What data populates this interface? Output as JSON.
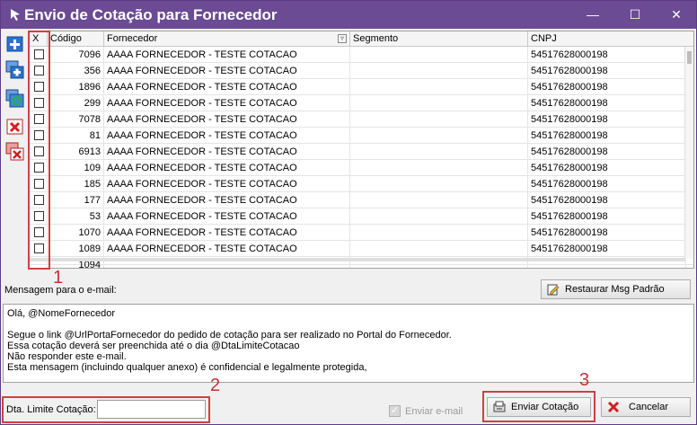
{
  "window": {
    "title": "Envio de Cotação para Fornecedor",
    "minimize": "—",
    "maximize": "☐",
    "close": "✕"
  },
  "grid": {
    "columns": [
      "X",
      "Código",
      "Fornecedor",
      "Segmento",
      "CNPJ"
    ],
    "rows": [
      {
        "codigo": "7096",
        "fornecedor": "AAAA FORNECEDOR - TESTE COTACAO",
        "segmento": "",
        "cnpj": "54517628000198"
      },
      {
        "codigo": "356",
        "fornecedor": "AAAA FORNECEDOR - TESTE COTACAO",
        "segmento": "",
        "cnpj": "54517628000198"
      },
      {
        "codigo": "1896",
        "fornecedor": "AAAA FORNECEDOR - TESTE COTACAO",
        "segmento": "",
        "cnpj": "54517628000198"
      },
      {
        "codigo": "299",
        "fornecedor": "AAAA FORNECEDOR - TESTE COTACAO",
        "segmento": "",
        "cnpj": "54517628000198"
      },
      {
        "codigo": "7078",
        "fornecedor": "AAAA FORNECEDOR - TESTE COTACAO",
        "segmento": "",
        "cnpj": "54517628000198"
      },
      {
        "codigo": "81",
        "fornecedor": "AAAA FORNECEDOR - TESTE COTACAO",
        "segmento": "",
        "cnpj": "54517628000198"
      },
      {
        "codigo": "6913",
        "fornecedor": "AAAA FORNECEDOR - TESTE COTACAO",
        "segmento": "",
        "cnpj": "54517628000198"
      },
      {
        "codigo": "109",
        "fornecedor": "AAAA FORNECEDOR - TESTE COTACAO",
        "segmento": "",
        "cnpj": "54517628000198"
      },
      {
        "codigo": "185",
        "fornecedor": "AAAA FORNECEDOR - TESTE COTACAO",
        "segmento": "",
        "cnpj": "54517628000198"
      },
      {
        "codigo": "177",
        "fornecedor": "AAAA FORNECEDOR - TESTE COTACAO",
        "segmento": "",
        "cnpj": "54517628000198"
      },
      {
        "codigo": "53",
        "fornecedor": "AAAA FORNECEDOR - TESTE COTACAO",
        "segmento": "",
        "cnpj": "54517628000198"
      },
      {
        "codigo": "1070",
        "fornecedor": "AAAA FORNECEDOR - TESTE COTACAO",
        "segmento": "",
        "cnpj": "54517628000198"
      },
      {
        "codigo": "1089",
        "fornecedor": "AAAA FORNECEDOR - TESTE COTACAO",
        "segmento": "",
        "cnpj": "54517628000198"
      },
      {
        "codigo": "1094",
        "fornecedor": "",
        "segmento": "",
        "cnpj": ""
      }
    ]
  },
  "annotations": [
    "1",
    "2",
    "3"
  ],
  "message": {
    "label": "Mensagem para o e-mail:",
    "restore_button": "Restaurar Msg Padrão",
    "lines": [
      "Olá, @NomeFornecedor",
      "",
      "Segue o link @UrlPortaFornecedor do pedido de cotação para ser realizado no Portal do Fornecedor.",
      "Essa cotação deverá ser preenchida até o dia @DtaLimiteCotacao",
      "Não responder este e-mail.",
      "Esta mensagem (incluindo qualquer anexo) é confidencial e legalmente protegida,"
    ]
  },
  "footer": {
    "deadline_label": "Dta. Limite Cotação:",
    "deadline_value": "",
    "email_checkbox_label": "Enviar e-mail",
    "send_button": "Enviar Cotação",
    "cancel_button": "Cancelar"
  },
  "colors": {
    "titlebar": "#6b4b93",
    "annotation_red": "#d04040"
  }
}
